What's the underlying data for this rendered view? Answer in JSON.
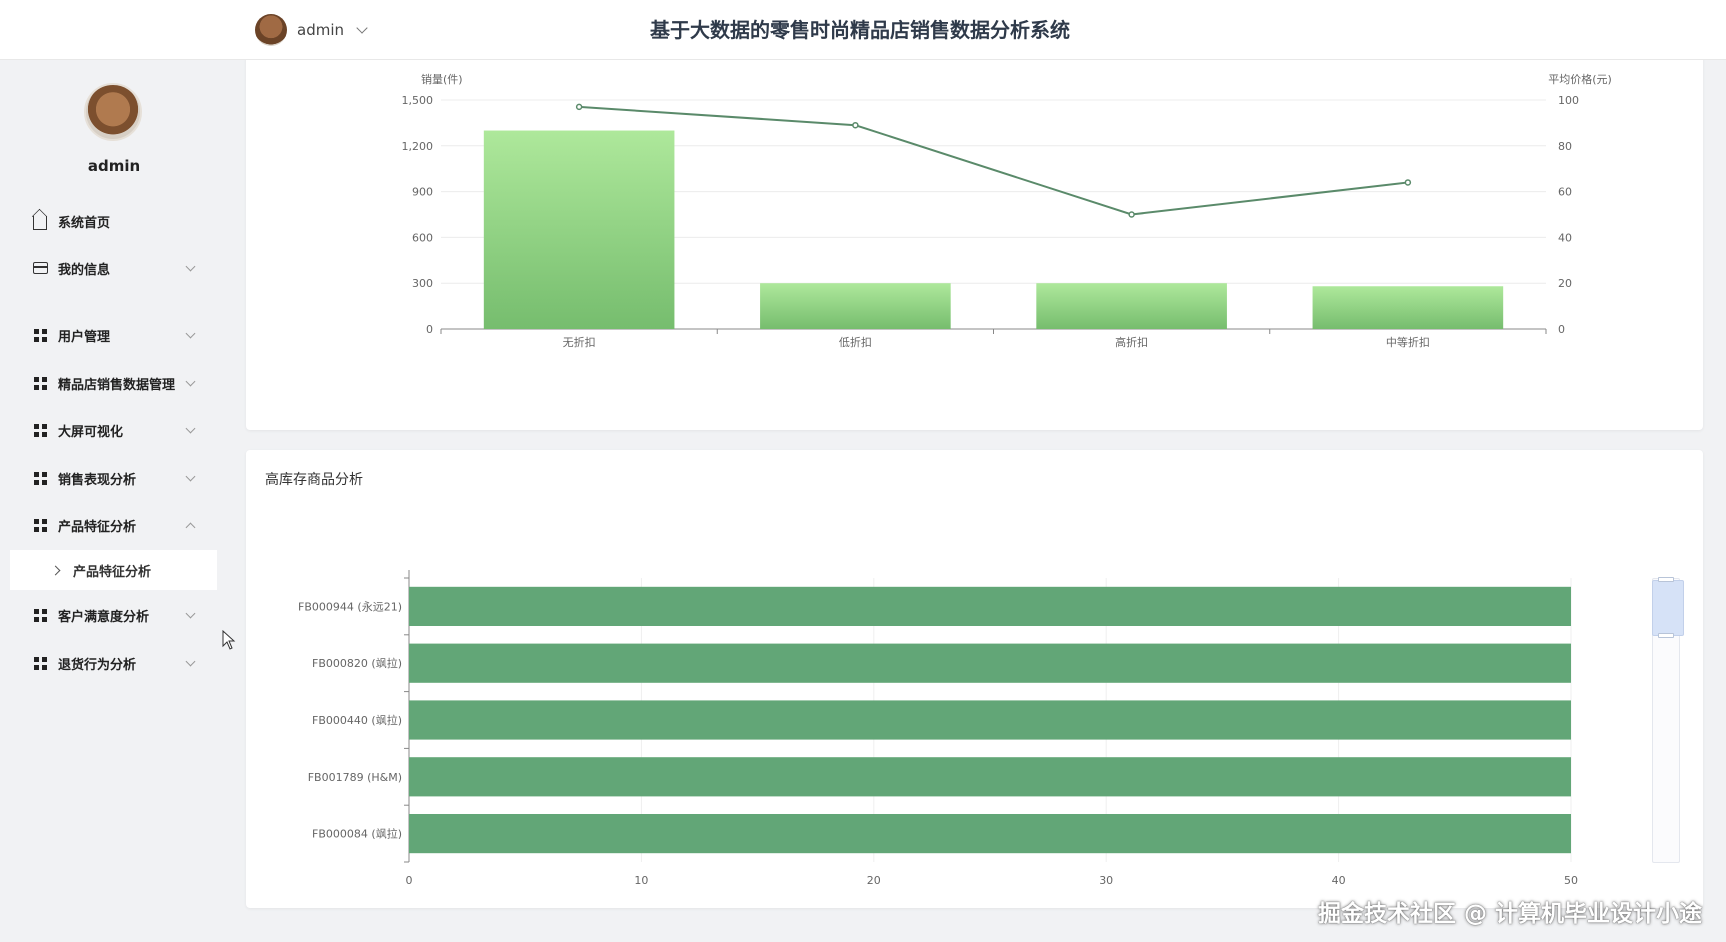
{
  "header": {
    "username": "admin",
    "system_title": "基于大数据的零售时尚精品店销售数据分析系统"
  },
  "sidebar": {
    "profile_name": "admin",
    "items": [
      {
        "label": "系统首页",
        "icon": "home-icon"
      },
      {
        "label": "我的信息",
        "icon": "card-icon"
      },
      {
        "label": "用户管理",
        "icon": "grid-icon"
      },
      {
        "label": "精品店销售数据管理",
        "icon": "grid-icon"
      },
      {
        "label": "大屏可视化",
        "icon": "grid-icon"
      },
      {
        "label": "销售表现分析",
        "icon": "grid-icon"
      },
      {
        "label": "产品特征分析",
        "icon": "grid-icon"
      },
      {
        "label": "客户满意度分析",
        "icon": "grid-icon"
      },
      {
        "label": "退货行为分析",
        "icon": "grid-icon"
      }
    ],
    "active_submenu": "产品特征分析"
  },
  "chart_data": [
    {
      "type": "bar",
      "categories": [
        "无折扣",
        "低折扣",
        "高折扣",
        "中等折扣"
      ],
      "series": [
        {
          "type": "bar",
          "axis": "left",
          "values": [
            1300,
            300,
            300,
            280
          ],
          "color": "#8fd17e"
        },
        {
          "type": "line",
          "axis": "right",
          "values": [
            97,
            89,
            50,
            64
          ],
          "color": "#5a8a6a"
        }
      ],
      "ylabel_left": "销量(件)",
      "ylabel_right": "平均价格(元)",
      "ylim_left": [
        0,
        1500
      ],
      "yticks_left": [
        "0",
        "300",
        "600",
        "900",
        "1,200",
        "1,500"
      ],
      "ylim_right": [
        0,
        100
      ],
      "yticks_right": [
        "0",
        "20",
        "40",
        "60",
        "80",
        "100"
      ],
      "grid": true
    },
    {
      "type": "bar",
      "orientation": "horizontal",
      "title": "高库存商品分析",
      "categories": [
        "FB000944 (永远21)",
        "FB000820 (飒拉)",
        "FB000440 (飒拉)",
        "FB001789 (H&M)",
        "FB000084 (飒拉)"
      ],
      "values": [
        50,
        50,
        50,
        50,
        50
      ],
      "color": "#62a677",
      "xlim": [
        0,
        50
      ],
      "xticks": [
        "0",
        "10",
        "20",
        "30",
        "40",
        "50"
      ],
      "grid": true
    }
  ],
  "watermark": "掘金技术社区 @ 计算机毕业设计小途"
}
